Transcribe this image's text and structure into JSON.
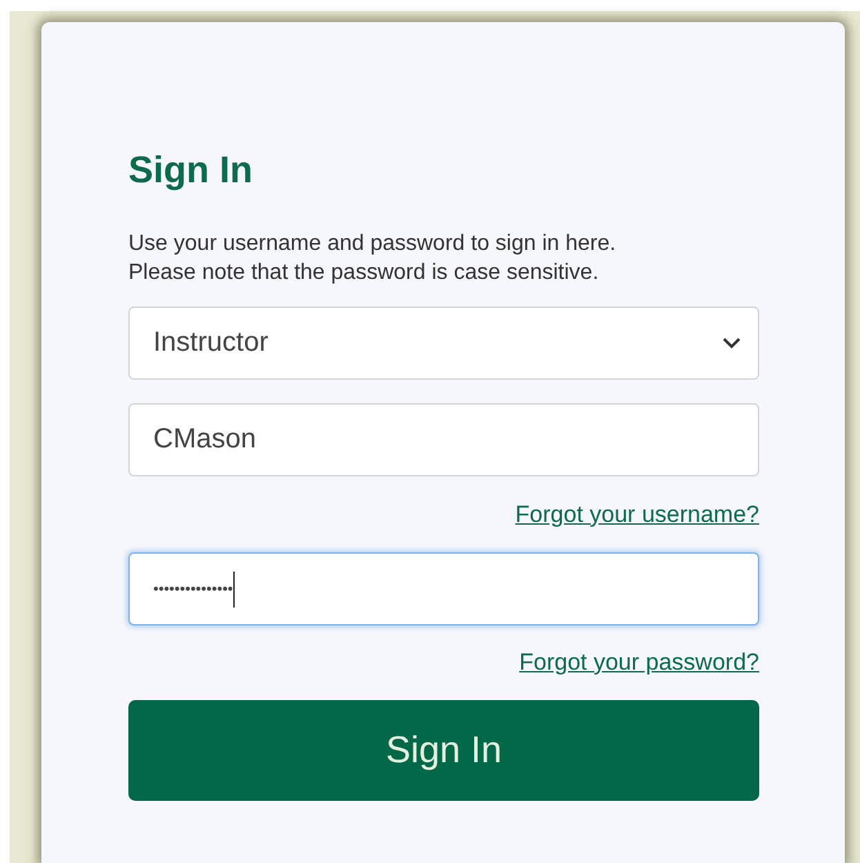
{
  "title": "Sign In",
  "instructions": "Use your username and password to sign in here. Please note that the password is case sensitive.",
  "role_select": {
    "value": "Instructor"
  },
  "username": {
    "value": "CMason"
  },
  "forgot_username_link": "Forgot your username?",
  "password": {
    "value": "•••••••••••••••",
    "focused": true
  },
  "forgot_password_link": "Forgot your password?",
  "submit_button": "Sign In"
}
